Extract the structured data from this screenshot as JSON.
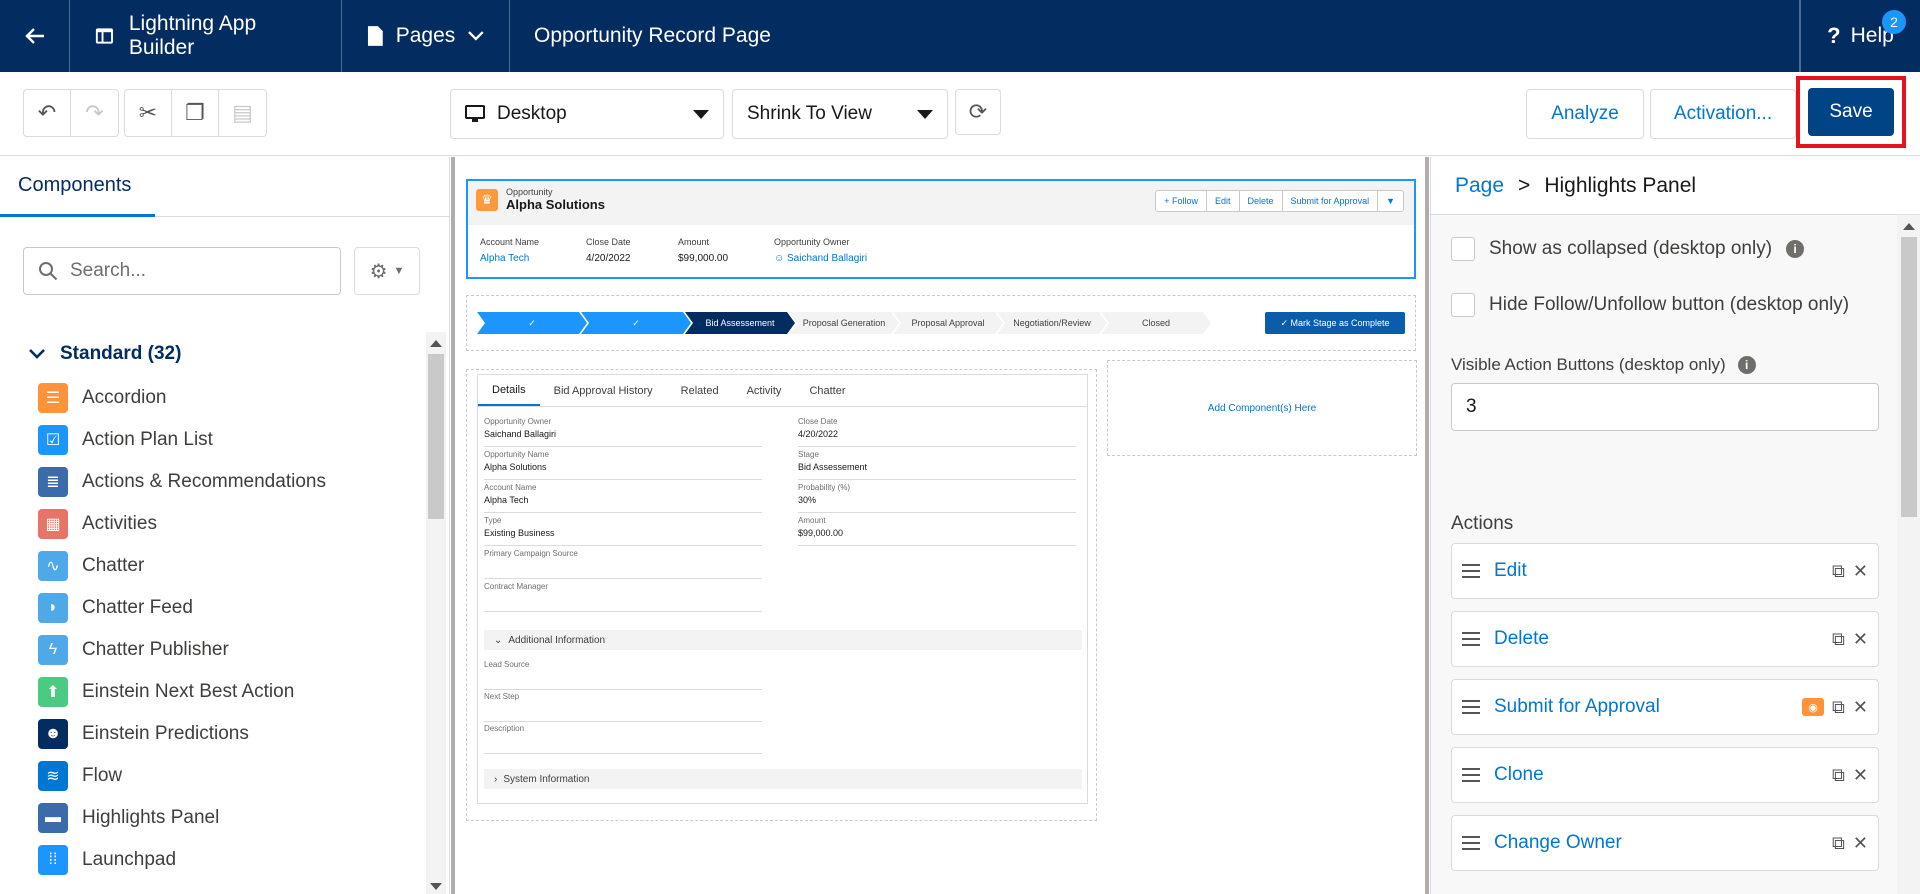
{
  "topbar": {
    "app_name": "Lightning App Builder",
    "pages_label": "Pages",
    "page_title": "Opportunity Record Page",
    "help_label": "Help",
    "help_badge": "2"
  },
  "toolbar": {
    "device_select": "Desktop",
    "zoom_select": "Shrink To View",
    "analyze_label": "Analyze",
    "activation_label": "Activation...",
    "save_label": "Save"
  },
  "left": {
    "tab_label": "Components",
    "search_placeholder": "Search...",
    "section_label": "Standard (32)",
    "components": [
      {
        "label": "Accordion",
        "icon": "accordion-icon",
        "color": "#fe9339"
      },
      {
        "label": "Action Plan List",
        "icon": "action-plan-icon",
        "color": "#1b96ff"
      },
      {
        "label": "Actions & Recommendations",
        "icon": "actions-icon",
        "color": "#3c6bab"
      },
      {
        "label": "Activities",
        "icon": "activities-icon",
        "color": "#e67469"
      },
      {
        "label": "Chatter",
        "icon": "chatter-icon",
        "color": "#4fa8e8"
      },
      {
        "label": "Chatter Feed",
        "icon": "chatter-feed-icon",
        "color": "#4fa8e8"
      },
      {
        "label": "Chatter Publisher",
        "icon": "chatter-publisher-icon",
        "color": "#4fa8e8"
      },
      {
        "label": "Einstein Next Best Action",
        "icon": "einstein-nba-icon",
        "color": "#4bca81"
      },
      {
        "label": "Einstein Predictions",
        "icon": "einstein-predictions-icon",
        "color": "#032d60"
      },
      {
        "label": "Flow",
        "icon": "flow-icon",
        "color": "#0176d3"
      },
      {
        "label": "Highlights Panel",
        "icon": "highlights-icon",
        "color": "#3c6bab"
      },
      {
        "label": "Launchpad",
        "icon": "launchpad-icon",
        "color": "#1b96ff"
      }
    ]
  },
  "canvas": {
    "object_label": "Opportunity",
    "record_name": "Alpha Solutions",
    "hp_buttons": [
      "+ Follow",
      "Edit",
      "Delete",
      "Submit for Approval"
    ],
    "hp_fields": [
      {
        "label": "Account Name",
        "value": "Alpha Tech"
      },
      {
        "label": "Close Date",
        "value": "4/20/2022"
      },
      {
        "label": "Amount",
        "value": "$99,000.00"
      },
      {
        "label": "Opportunity Owner",
        "value": "Saichand Ballagiri"
      }
    ],
    "stages": [
      "",
      "",
      "Bid Assessement",
      "Proposal Generation",
      "Proposal Approval",
      "Negotiation/Review",
      "Closed"
    ],
    "mark_stage": "Mark Stage as Complete",
    "detail_tabs": [
      "Details",
      "Bid Approval History",
      "Related",
      "Activity",
      "Chatter"
    ],
    "detail_fields_left": [
      {
        "label": "Opportunity Owner",
        "value": "Saichand Ballagiri"
      },
      {
        "label": "Opportunity Name",
        "value": "Alpha Solutions"
      },
      {
        "label": "Account Name",
        "value": "Alpha Tech"
      },
      {
        "label": "Type",
        "value": "Existing Business"
      },
      {
        "label": "Primary Campaign Source",
        "value": ""
      },
      {
        "label": "Contract Manager",
        "value": ""
      }
    ],
    "detail_fields_right": [
      {
        "label": "Close Date",
        "value": "4/20/2022"
      },
      {
        "label": "Stage",
        "value": "Bid Assessement"
      },
      {
        "label": "Probability (%)",
        "value": "30%"
      },
      {
        "label": "Amount",
        "value": "$99,000.00"
      }
    ],
    "additional_info": "Additional Information",
    "additional_fields": [
      {
        "label": "Lead Source"
      },
      {
        "label": "Next Step"
      },
      {
        "label": "Description"
      }
    ],
    "system_info": "System Information",
    "add_component": "Add Component(s) Here"
  },
  "right": {
    "breadcrumb_page": "Page",
    "breadcrumb_sep": ">",
    "breadcrumb_current": "Highlights Panel",
    "opt_collapsed": "Show as collapsed (desktop only)",
    "opt_hide_follow": "Hide Follow/Unfollow button (desktop only)",
    "visible_actions_label": "Visible Action Buttons (desktop only)",
    "visible_actions_value": "3",
    "actions_label": "Actions",
    "actions": [
      "Edit",
      "Delete",
      "Submit for Approval",
      "Clone",
      "Change Owner"
    ]
  }
}
